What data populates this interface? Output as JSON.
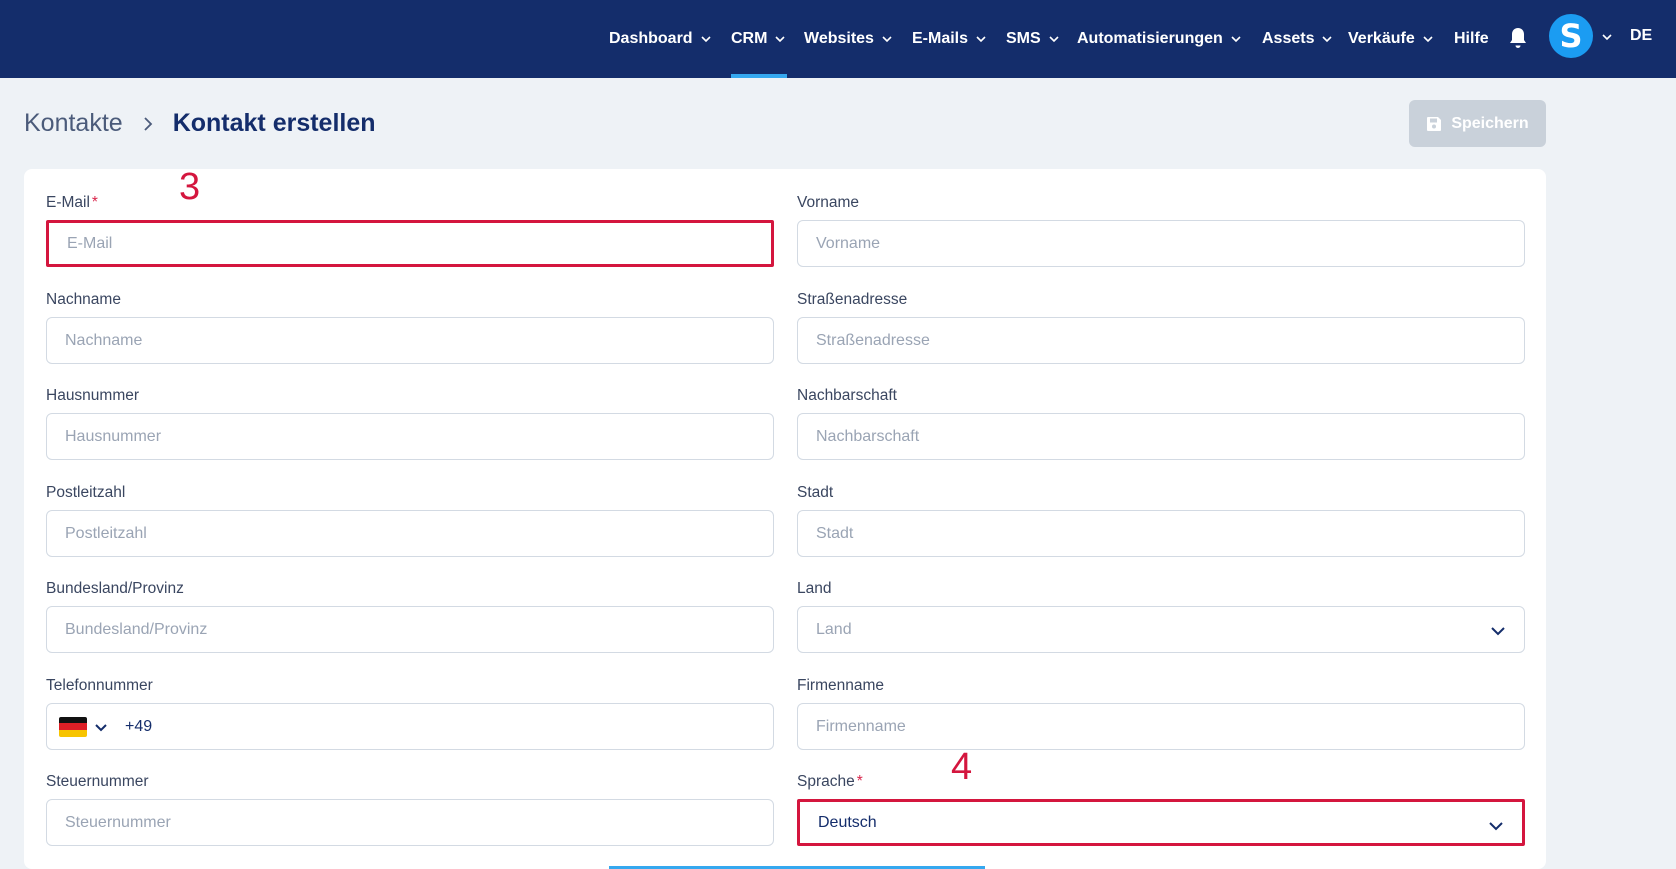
{
  "nav": {
    "items": [
      {
        "label": "Dashboard",
        "has_menu": true
      },
      {
        "label": "CRM",
        "has_menu": true,
        "active": true
      },
      {
        "label": "Websites",
        "has_menu": true
      },
      {
        "label": "E-Mails",
        "has_menu": true
      },
      {
        "label": "SMS",
        "has_menu": true
      },
      {
        "label": "Automatisierungen",
        "has_menu": true
      },
      {
        "label": "Assets",
        "has_menu": true
      },
      {
        "label": "Verkäufe",
        "has_menu": true
      },
      {
        "label": "Hilfe",
        "has_menu": false
      }
    ],
    "avatar_letter": "S",
    "language": "DE"
  },
  "header": {
    "breadcrumb_root": "Kontakte",
    "breadcrumb_current": "Kontakt erstellen",
    "save_label": "Speichern"
  },
  "form": {
    "email": {
      "label": "E-Mail",
      "placeholder": "E-Mail",
      "required": true
    },
    "firstname": {
      "label": "Vorname",
      "placeholder": "Vorname"
    },
    "lastname": {
      "label": "Nachname",
      "placeholder": "Nachname"
    },
    "street": {
      "label": "Straßenadresse",
      "placeholder": "Straßenadresse"
    },
    "housenumber": {
      "label": "Hausnummer",
      "placeholder": "Hausnummer"
    },
    "neighborhood": {
      "label": "Nachbarschaft",
      "placeholder": "Nachbarschaft"
    },
    "zip": {
      "label": "Postleitzahl",
      "placeholder": "Postleitzahl"
    },
    "city": {
      "label": "Stadt",
      "placeholder": "Stadt"
    },
    "state": {
      "label": "Bundesland/Provinz",
      "placeholder": "Bundesland/Provinz"
    },
    "country": {
      "label": "Land",
      "placeholder": "Land"
    },
    "phone": {
      "label": "Telefonnummer",
      "code": "+49",
      "flag": "germany-flag"
    },
    "company": {
      "label": "Firmenname",
      "placeholder": "Firmenname"
    },
    "taxnumber": {
      "label": "Steuernummer",
      "placeholder": "Steuernummer"
    },
    "language": {
      "label": "Sprache",
      "value": "Deutsch",
      "required": true
    }
  },
  "annotations": {
    "email_marker": "3",
    "language_marker": "4"
  },
  "colors": {
    "nav_bg": "#142d6b",
    "accent": "#35a8ef",
    "highlight": "#d4163e"
  }
}
